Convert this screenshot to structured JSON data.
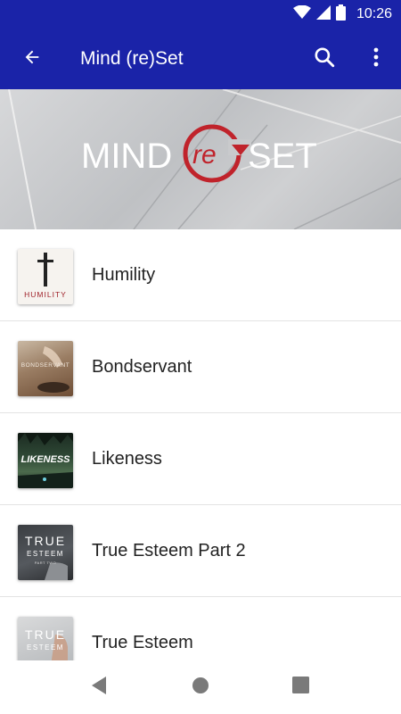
{
  "status_bar": {
    "time": "10:26",
    "icons": [
      "wifi-icon",
      "cellular-icon",
      "battery-icon"
    ]
  },
  "app_bar": {
    "title": "Mind (re)Set",
    "back_icon": "arrow-back-icon",
    "search_icon": "search-icon",
    "more_icon": "more-vert-icon",
    "color": "#1a23a8"
  },
  "banner": {
    "logo_left": "MIND",
    "logo_mid": "re",
    "logo_right": "SET",
    "accent": "#c0232b"
  },
  "series": [
    {
      "title": "Humility",
      "thumb_text": "HUMILITY"
    },
    {
      "title": "Bondservant",
      "thumb_text": "BONDSERVANT"
    },
    {
      "title": "Likeness",
      "thumb_text": "LIKENESS"
    },
    {
      "title": "True Esteem Part 2",
      "thumb_text_top": "TRUE",
      "thumb_text_bottom": "ESTEEM",
      "thumb_text_small": "PART TWO"
    },
    {
      "title": "True Esteem",
      "thumb_text_top": "TRUE",
      "thumb_text_bottom": "ESTEEM"
    }
  ],
  "nav_bar": {
    "icons": [
      "back-triangle-icon",
      "home-circle-icon",
      "recents-square-icon"
    ]
  }
}
